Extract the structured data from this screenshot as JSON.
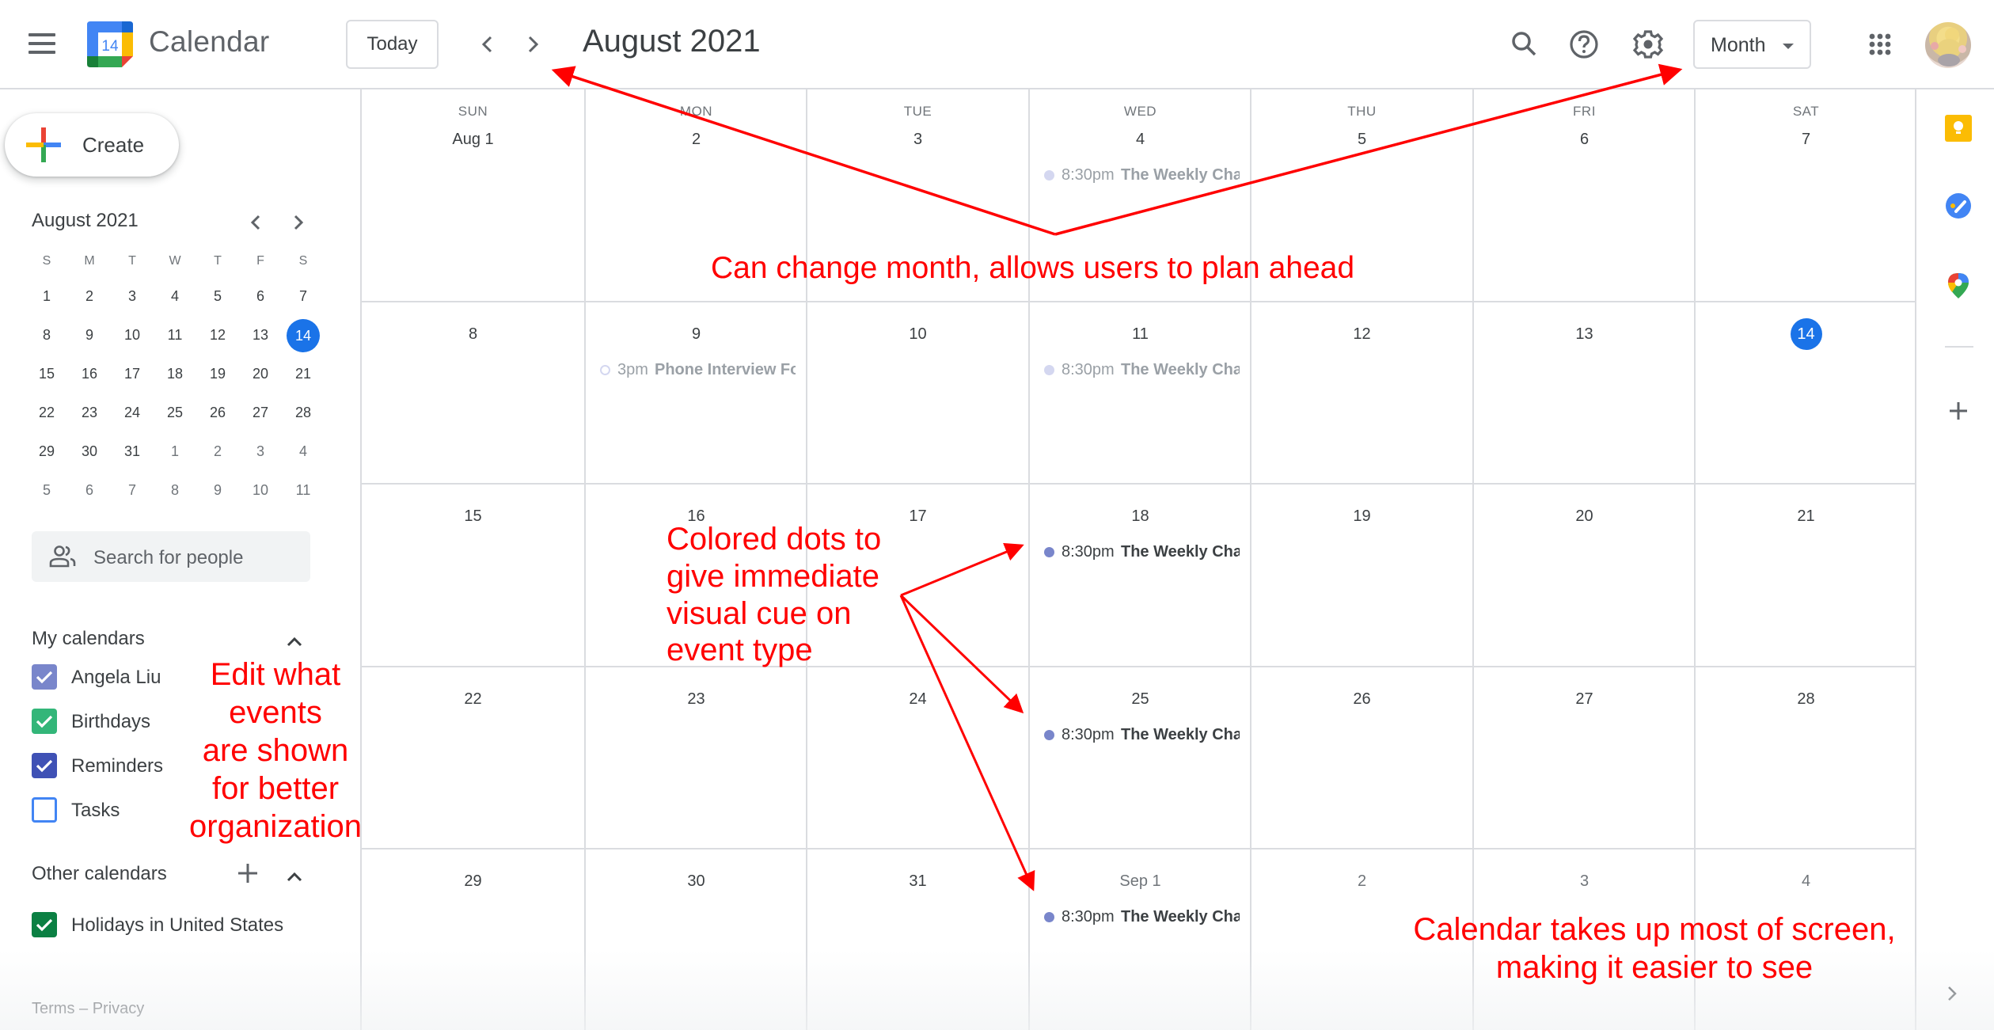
{
  "header": {
    "menu_icon": "hamburger-menu-icon",
    "logo_day": "14",
    "app_name": "Calendar",
    "today_label": "Today",
    "prev_icon": "chevron-left-icon",
    "next_icon": "chevron-right-icon",
    "current_period": "August 2021",
    "search_icon": "search-icon",
    "help_icon": "help-icon",
    "settings_icon": "gear-icon",
    "view_selector": "Month",
    "apps_icon": "apps-grid-icon",
    "avatar": "account-avatar"
  },
  "sidebar": {
    "create_label": "Create",
    "mini_calendar": {
      "title": "August 2021",
      "weekday_initials": [
        "S",
        "M",
        "T",
        "W",
        "T",
        "F",
        "S"
      ],
      "weeks": [
        [
          {
            "d": "1"
          },
          {
            "d": "2"
          },
          {
            "d": "3"
          },
          {
            "d": "4"
          },
          {
            "d": "5"
          },
          {
            "d": "6"
          },
          {
            "d": "7"
          }
        ],
        [
          {
            "d": "8"
          },
          {
            "d": "9"
          },
          {
            "d": "10"
          },
          {
            "d": "11"
          },
          {
            "d": "12"
          },
          {
            "d": "13"
          },
          {
            "d": "14",
            "today": true
          }
        ],
        [
          {
            "d": "15"
          },
          {
            "d": "16"
          },
          {
            "d": "17"
          },
          {
            "d": "18"
          },
          {
            "d": "19"
          },
          {
            "d": "20"
          },
          {
            "d": "21"
          }
        ],
        [
          {
            "d": "22"
          },
          {
            "d": "23"
          },
          {
            "d": "24"
          },
          {
            "d": "25"
          },
          {
            "d": "26"
          },
          {
            "d": "27"
          },
          {
            "d": "28"
          }
        ],
        [
          {
            "d": "29"
          },
          {
            "d": "30"
          },
          {
            "d": "31"
          },
          {
            "d": "1",
            "other": true
          },
          {
            "d": "2",
            "other": true
          },
          {
            "d": "3",
            "other": true
          },
          {
            "d": "4",
            "other": true
          }
        ],
        [
          {
            "d": "5",
            "other": true
          },
          {
            "d": "6",
            "other": true
          },
          {
            "d": "7",
            "other": true
          },
          {
            "d": "8",
            "other": true
          },
          {
            "d": "9",
            "other": true
          },
          {
            "d": "10",
            "other": true
          },
          {
            "d": "11",
            "other": true
          }
        ]
      ]
    },
    "people_search_placeholder": "Search for people",
    "my_calendars": {
      "title": "My calendars",
      "items": [
        {
          "label": "Angela Liu",
          "checked": true,
          "color": "#7986cb"
        },
        {
          "label": "Birthdays",
          "checked": true,
          "color": "#33b679"
        },
        {
          "label": "Reminders",
          "checked": true,
          "color": "#3f51b5"
        },
        {
          "label": "Tasks",
          "checked": false,
          "color": "#4285f4"
        }
      ]
    },
    "other_calendars": {
      "title": "Other calendars",
      "items": [
        {
          "label": "Holidays in United States",
          "checked": true,
          "color": "#0b8043"
        }
      ]
    },
    "footer": {
      "terms": "Terms",
      "separator": " – ",
      "privacy": "Privacy"
    }
  },
  "grid": {
    "weekdays": [
      "SUN",
      "MON",
      "TUE",
      "WED",
      "THU",
      "FRI",
      "SAT"
    ],
    "weeks": [
      [
        {
          "label": "Aug 1"
        },
        {
          "label": "2"
        },
        {
          "label": "3"
        },
        {
          "label": "4",
          "events": [
            {
              "time": "8:30pm",
              "title": "The Weekly Cha",
              "past": true,
              "dot": "#d4d7f0",
              "dot_style": "filled"
            }
          ]
        },
        {
          "label": "5"
        },
        {
          "label": "6"
        },
        {
          "label": "7"
        }
      ],
      [
        {
          "label": "8"
        },
        {
          "label": "9",
          "events": [
            {
              "time": "3pm",
              "title": "Phone Interview Fo",
              "past": true,
              "dot": "#d4d7f0",
              "dot_style": "outline"
            }
          ]
        },
        {
          "label": "10"
        },
        {
          "label": "11",
          "events": [
            {
              "time": "8:30pm",
              "title": "The Weekly Cha",
              "past": true,
              "dot": "#d4d7f0",
              "dot_style": "filled"
            }
          ]
        },
        {
          "label": "12"
        },
        {
          "label": "13"
        },
        {
          "label": "14",
          "today": true
        }
      ],
      [
        {
          "label": "15"
        },
        {
          "label": "16"
        },
        {
          "label": "17"
        },
        {
          "label": "18",
          "events": [
            {
              "time": "8:30pm",
              "title": "The Weekly Cha",
              "past": false,
              "dot": "#7986cb",
              "dot_style": "filled"
            }
          ]
        },
        {
          "label": "19"
        },
        {
          "label": "20"
        },
        {
          "label": "21"
        }
      ],
      [
        {
          "label": "22"
        },
        {
          "label": "23"
        },
        {
          "label": "24"
        },
        {
          "label": "25",
          "events": [
            {
              "time": "8:30pm",
              "title": "The Weekly Cha",
              "past": false,
              "dot": "#7986cb",
              "dot_style": "filled"
            }
          ]
        },
        {
          "label": "26"
        },
        {
          "label": "27"
        },
        {
          "label": "28"
        }
      ],
      [
        {
          "label": "29"
        },
        {
          "label": "30"
        },
        {
          "label": "31"
        },
        {
          "label": "Sep 1",
          "other": true,
          "events": [
            {
              "time": "8:30pm",
              "title": "The Weekly Cha",
              "past": false,
              "dot": "#7986cb",
              "dot_style": "filled"
            }
          ]
        },
        {
          "label": "2",
          "other": true
        },
        {
          "label": "3",
          "other": true
        },
        {
          "label": "4",
          "other": true
        }
      ]
    ]
  },
  "side_panel": {
    "items": [
      "keep-icon",
      "tasks-icon",
      "maps-icon"
    ],
    "add_icon": "plus-icon",
    "expand_icon": "chevron-right-icon"
  },
  "annotations": {
    "month_nav": "Can change month, allows users to plan ahead",
    "colored_dots": [
      "Colored dots to",
      "give immediate",
      "visual cue on",
      "event type"
    ],
    "edit_events": [
      "Edit what",
      "events",
      "are shown",
      "for better",
      "organization"
    ],
    "calendar_size": [
      "Calendar takes up most of screen,",
      "making it easier to see"
    ],
    "color": "#ff0000"
  },
  "colors": {
    "accent": "#1a73e8",
    "border": "#dadce0",
    "text": "#3c4043",
    "muted": "#70757a"
  }
}
